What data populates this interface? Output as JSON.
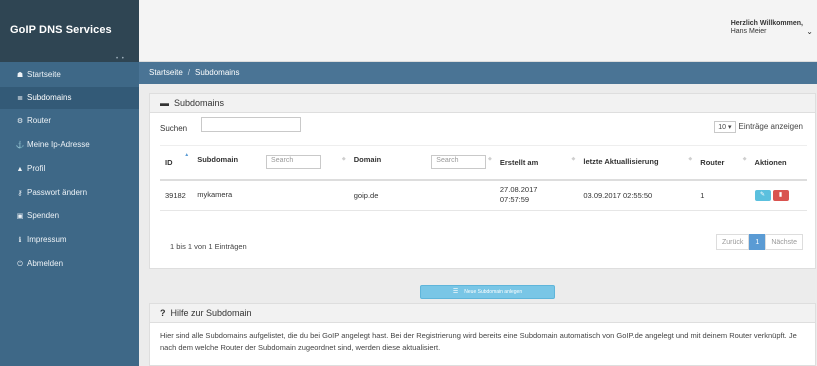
{
  "brand": {
    "title": "GoIP DNS Services",
    "dots": "• •"
  },
  "user": {
    "greeting": "Herzlich Willkommen,",
    "name": "Hans Meier",
    "caret": "⌄"
  },
  "sidebar": {
    "items": [
      {
        "icon": "☗",
        "label": "Startseite"
      },
      {
        "icon": "≣",
        "label": "Subdomains"
      },
      {
        "icon": "⚙",
        "label": "Router"
      },
      {
        "icon": "⚓",
        "label": "Meine Ip-Adresse"
      },
      {
        "icon": "▲",
        "label": "Profil"
      },
      {
        "icon": "⚷",
        "label": "Passwort ändern"
      },
      {
        "icon": "▣",
        "label": "Spenden"
      },
      {
        "icon": "ℹ",
        "label": "Impressum"
      },
      {
        "icon": "⏻",
        "label": "Abmelden"
      }
    ]
  },
  "breadcrumb": {
    "home": "Startseite",
    "sep": "/",
    "current": "Subdomains"
  },
  "subdomains": {
    "title": "Subdomains",
    "search_label": "Suchen",
    "entries_value": "10",
    "entries_label": "Einträge anzeigen",
    "columns": {
      "id": "ID",
      "subdomain": "Subdomain",
      "subdomain_search": "Search",
      "domain": "Domain",
      "domain_search": "Search",
      "created": "Erstellt am",
      "updated": "letzte Aktuallisierung",
      "router": "Router",
      "actions": "Aktionen"
    },
    "rows": [
      {
        "id": "39182",
        "subdomain": "mykamera",
        "domain": "goip.de",
        "created": "27.08.2017 07:57:59",
        "updated": "03.09.2017 02:55:50",
        "router": "1"
      }
    ],
    "info": "1 bis 1 von 1 Einträgen",
    "pager": {
      "prev": "Zurück",
      "page": "1",
      "next": "Nächste"
    }
  },
  "new_button": "Neue Subdomain anlegen",
  "help": {
    "title": "Hilfe zur Subdomain",
    "text": "Hier sind alle Subdomains aufgelistet, die du bei GoIP angelegt hast. Bei der Registrierung wird bereits eine Subdomain automatisch von GoIP.de angelegt und mit deinem Router verknüpft. Je nach dem welche Router der Subdomain zugeordnet sind, werden diese aktualisiert."
  },
  "colors": {
    "sidebar": "#3e6887",
    "brand": "#2f4553",
    "crumbbar": "#4a7495",
    "accent": "#5a9bd4",
    "delete": "#d9534f",
    "edit": "#5bc0de"
  }
}
